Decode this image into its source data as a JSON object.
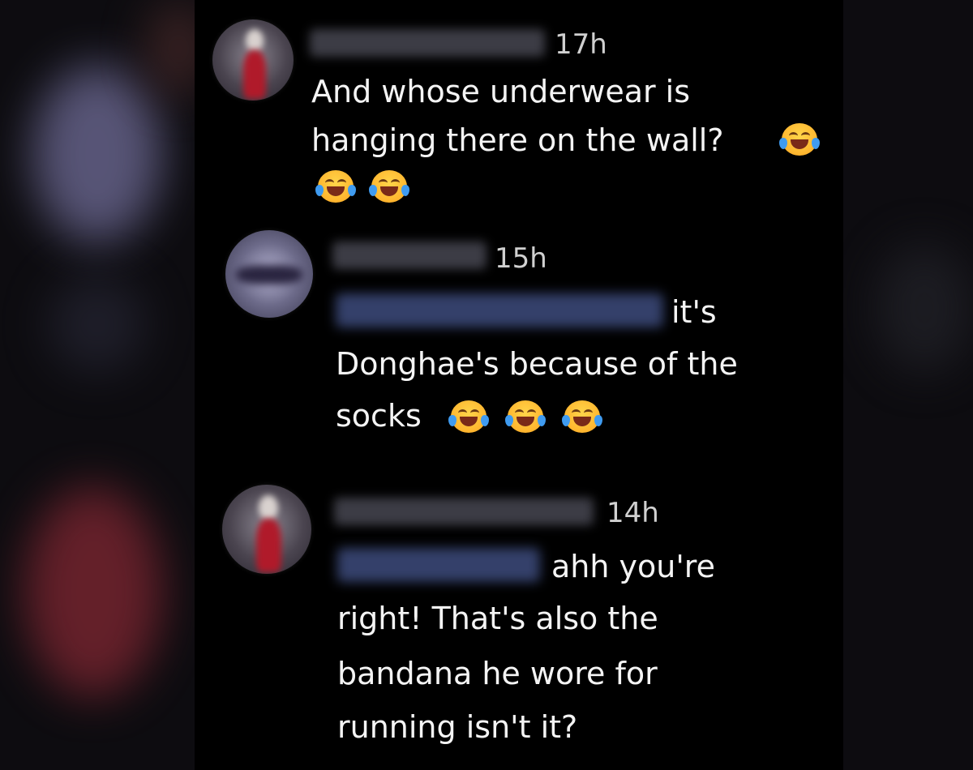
{
  "comments": [
    {
      "time": "17h",
      "lines": [
        "And whose underwear is",
        "hanging there on the wall?"
      ],
      "emoji": "face-with-tears-of-joy-icon"
    },
    {
      "time": "15h",
      "lines": [
        "it's",
        "Donghae's because of the",
        "socks"
      ],
      "emoji": "face-with-tears-of-joy-icon"
    },
    {
      "time": "14h",
      "lines": [
        "ahh you're",
        "right! That's also the",
        "bandana he wore for",
        "running isn't it?"
      ]
    }
  ],
  "colors": {
    "background": "#000000",
    "text": "#f4f4f4",
    "timestamp": "#d0d0d0"
  }
}
